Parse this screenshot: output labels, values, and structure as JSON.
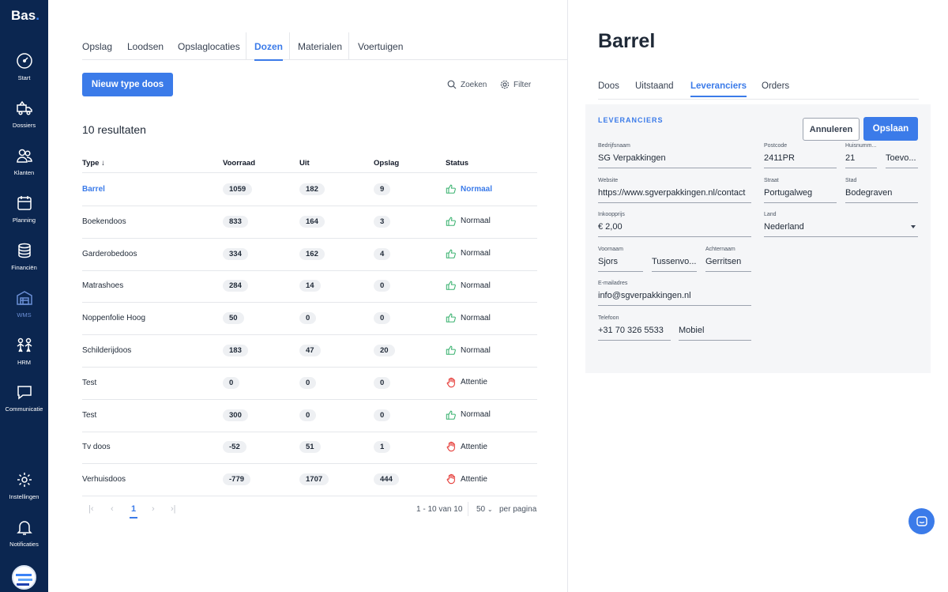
{
  "brand": {
    "name": "Bas",
    "dot": "."
  },
  "sidebar": {
    "items": [
      {
        "label": "Start",
        "icon": "dashboard-gauge-icon"
      },
      {
        "label": "Dossiers",
        "icon": "moving-truck-icon"
      },
      {
        "label": "Klanten",
        "icon": "users-icon"
      },
      {
        "label": "Planning",
        "icon": "calendar-icon"
      },
      {
        "label": "Financiën",
        "icon": "coins-stack-icon"
      },
      {
        "label": "WMS",
        "icon": "warehouse-icon"
      },
      {
        "label": "HRM",
        "icon": "team-icon"
      },
      {
        "label": "Communicatie",
        "icon": "chat-bubble-icon"
      }
    ],
    "bottom_items": [
      {
        "label": "Instellingen",
        "icon": "gear-icon"
      },
      {
        "label": "Notificaties",
        "icon": "bell-icon"
      }
    ]
  },
  "list_tabs": [
    "Opslag",
    "Loodsen",
    "Opslaglocaties",
    "Dozen",
    "Materialen",
    "Voertuigen"
  ],
  "active_list_tab": "Dozen",
  "new_button": "Nieuw type doos",
  "search_label": "Zoeken",
  "filter_label": "Filter",
  "results_label": "10 resultaten",
  "table": {
    "columns": [
      "Type",
      "Voorraad",
      "Uit",
      "Opslag",
      "Status"
    ],
    "sort_indicator": "↓",
    "rows": [
      {
        "type": "Barrel",
        "voorraad": "1059",
        "uit": "182",
        "opslag": "9",
        "status": "Normaal"
      },
      {
        "type": "Boekendoos",
        "voorraad": "833",
        "uit": "164",
        "opslag": "3",
        "status": "Normaal"
      },
      {
        "type": "Garderobedoos",
        "voorraad": "334",
        "uit": "162",
        "opslag": "4",
        "status": "Normaal"
      },
      {
        "type": "Matrashoes",
        "voorraad": "284",
        "uit": "14",
        "opslag": "0",
        "status": "Normaal"
      },
      {
        "type": "Noppenfolie Hoog",
        "voorraad": "50",
        "uit": "0",
        "opslag": "0",
        "status": "Normaal"
      },
      {
        "type": "Schilderijdoos",
        "voorraad": "183",
        "uit": "47",
        "opslag": "20",
        "status": "Normaal"
      },
      {
        "type": "Test",
        "voorraad": "0",
        "uit": "0",
        "opslag": "0",
        "status": "Attentie"
      },
      {
        "type": "Test",
        "voorraad": "300",
        "uit": "0",
        "opslag": "0",
        "status": "Normaal"
      },
      {
        "type": "Tv doos",
        "voorraad": "-52",
        "uit": "51",
        "opslag": "1",
        "status": "Attentie"
      },
      {
        "type": "Verhuisdoos",
        "voorraad": "-779",
        "uit": "1707",
        "opslag": "444",
        "status": "Attentie"
      }
    ]
  },
  "pagination": {
    "current_page": "1",
    "range": "1 - 10 van 10",
    "per_page": "50",
    "per_page_label": "per pagina"
  },
  "detail": {
    "title": "Barrel",
    "tabs": [
      "Doos",
      "Uitstaand",
      "Leveranciers",
      "Orders"
    ],
    "active_tab": "Leveranciers",
    "section_title": "LEVERANCIERS",
    "cancel_button": "Annuleren",
    "save_button": "Opslaan",
    "fields": {
      "bedrijfsnaam": {
        "label": "Bedrijfsnaam",
        "value": "SG Verpakkingen"
      },
      "postcode": {
        "label": "Postcode",
        "value": "2411PR"
      },
      "huisnummer": {
        "label": "Huisnumm...",
        "value": "21"
      },
      "toevoeging": {
        "label": "",
        "value": "Toevo..."
      },
      "website": {
        "label": "Website",
        "value": "https://www.sgverpakkingen.nl/contact"
      },
      "straat": {
        "label": "Straat",
        "value": "Portugalweg"
      },
      "stad": {
        "label": "Stad",
        "value": "Bodegraven"
      },
      "inkoopprijs": {
        "label": "Inkoopprijs",
        "value": "€ 2,00"
      },
      "land": {
        "label": "Land",
        "value": "Nederland"
      },
      "voornaam": {
        "label": "Voornaam",
        "value": "Sjors"
      },
      "tussenvoegsel": {
        "label": "",
        "value": "Tussenvo..."
      },
      "achternaam": {
        "label": "Achternaam",
        "value": "Gerritsen"
      },
      "email": {
        "label": "E-mailadres",
        "value": "info@sgverpakkingen.nl"
      },
      "telefoon": {
        "label": "Telefoon",
        "value": "+31 70 326 5533"
      },
      "mobiel": {
        "label": "",
        "value": "Mobiel"
      }
    }
  },
  "colors": {
    "sidebar": "#0b2650",
    "accent": "#3b7be9",
    "ok": "#3cb371",
    "attention": "#e53935"
  }
}
